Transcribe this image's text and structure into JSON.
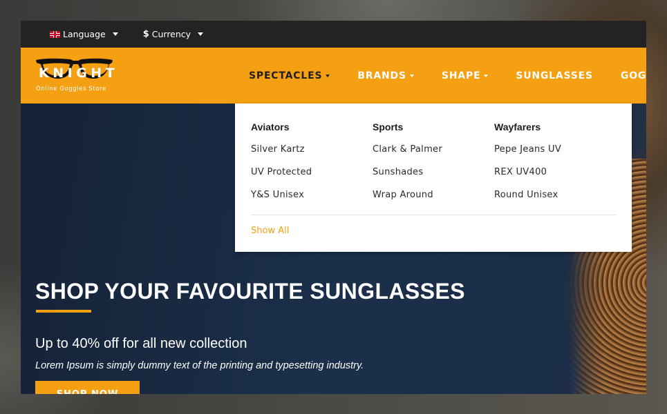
{
  "topbar": {
    "language": "Language",
    "currency_symbol": "$",
    "currency": "Currency"
  },
  "brand": {
    "name": "KNIGHT",
    "tagline": "Online Goggles Store"
  },
  "nav": {
    "items": [
      {
        "label": "SPECTACLES",
        "has_dropdown": true,
        "active": true
      },
      {
        "label": "BRANDS",
        "has_dropdown": true
      },
      {
        "label": "SHAPE",
        "has_dropdown": true
      },
      {
        "label": "SUNGLASSES",
        "has_dropdown": false
      },
      {
        "label": "GOGGLES",
        "has_dropdown": false
      }
    ]
  },
  "megamenu": {
    "columns": [
      {
        "title": "Aviators",
        "links": [
          "Silver Kartz",
          "UV Protected",
          "Y&S Unisex"
        ]
      },
      {
        "title": "Sports",
        "links": [
          "Clark & Palmer",
          "Sunshades",
          "Wrap Around"
        ]
      },
      {
        "title": "Wayfarers",
        "links": [
          "Pepe Jeans UV",
          "REX UV400",
          "Round Unisex"
        ]
      }
    ],
    "show_all": "Show All"
  },
  "hero": {
    "title": "SHOP YOUR FAVOURITE SUNGLASSES",
    "subtitle": "Up to 40% off  for all new collection",
    "description": "Lorem Ipsum is simply dummy text of the printing and typesetting industry.",
    "cta": "SHOP NOW"
  },
  "colors": {
    "accent": "#f59f12",
    "topbar": "#232323",
    "hero_bg": "#1b2f4a"
  }
}
